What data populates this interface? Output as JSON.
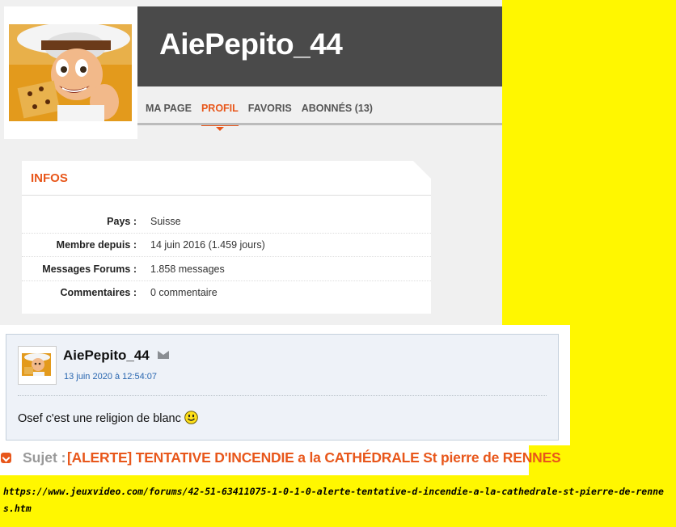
{
  "profile": {
    "username": "AiePepito_44",
    "tabs": [
      {
        "label": "MA PAGE",
        "active": false
      },
      {
        "label": "PROFIL",
        "active": true
      },
      {
        "label": "FAVORIS",
        "active": false
      },
      {
        "label": "ABONNÉS (13)",
        "active": false
      }
    ],
    "infos": {
      "title": "INFOS",
      "rows": [
        {
          "label": "Pays :",
          "value": "Suisse"
        },
        {
          "label": "Membre depuis :",
          "value": "14 juin 2016 (1.459 jours)"
        },
        {
          "label": "Messages Forums :",
          "value": "1.858 messages"
        },
        {
          "label": "Commentaires :",
          "value": "0 commentaire"
        }
      ]
    }
  },
  "message": {
    "author": "AiePepito_44",
    "date": "13 juin 2020 à 12:54:07",
    "text": "Osef c'est une religion de blanc"
  },
  "subject": {
    "label": "Sujet :",
    "title": "[ALERTE] TENTATIVE D'INCENDIE a la CATHÉDRALE St pierre de RENNES"
  },
  "url": "https://www.jeuxvideo.com/forums/42-51-63411075-1-0-1-0-alerte-tentative-d-incendie-a-la-cathedrale-st-pierre-de-rennes.htm",
  "colors": {
    "accent": "#e8571b",
    "background": "#fff700",
    "header": "#4a4a4a"
  }
}
